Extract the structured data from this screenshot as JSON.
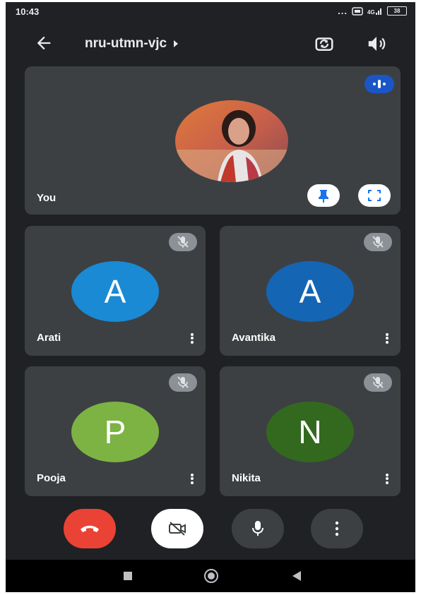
{
  "status_bar": {
    "time": "10:43",
    "signal_dots": "...",
    "battery": "38"
  },
  "top_bar": {
    "meeting_code": "nru-utmn-vjc",
    "back_icon": "arrow-left-icon",
    "switch_camera_icon": "switch-camera-icon",
    "speaker_icon": "volume-icon"
  },
  "self_tile": {
    "name": "You",
    "speaking_indicator_icon": "audio-levels-icon",
    "pin_icon": "pin-icon",
    "fullscreen_icon": "fullscreen-icon"
  },
  "participants": [
    {
      "name": "Arati",
      "initial": "A",
      "color": "#1a8ad4"
    },
    {
      "name": "Avantika",
      "initial": "A",
      "color": "#1565b5"
    },
    {
      "name": "Pooja",
      "initial": "P",
      "color": "#7cb342"
    },
    {
      "name": "Nikita",
      "initial": "N",
      "color": "#33691e"
    }
  ],
  "controls": {
    "end_call_icon": "phone-hangup-icon",
    "camera_icon": "camera-off-icon",
    "mic_icon": "microphone-icon",
    "more_icon": "more-vert-icon"
  },
  "colors": {
    "background": "#202124",
    "tile": "#3c4043",
    "end_call": "#ea4335",
    "speaking_badge": "#1a56c6"
  }
}
